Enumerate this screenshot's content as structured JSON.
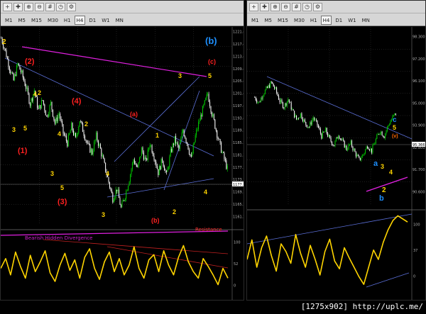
{
  "status_bar": {
    "text": "[1275x902] http://uplc.me/"
  },
  "windows": [
    {
      "id": "left",
      "toolbar": {
        "icons": [
          "new-chart-icon",
          "crosshair-icon",
          "zoom-in-icon",
          "zoom-out-icon",
          "grid-icon",
          "period-icon",
          "properties-icon"
        ],
        "timeframes": [
          "M1",
          "M5",
          "M15",
          "M30",
          "H1",
          "H4",
          "D1",
          "W1",
          "MN"
        ],
        "active_timeframe": "H4"
      },
      "price_axis": [
        "1221.40",
        "1217.45",
        "1213.45",
        "1209.40",
        "1205.40",
        "1201.40",
        "1197.40",
        "1193.40",
        "1189.30",
        "1185.30",
        "1181.30",
        "1177.30",
        "1173.30",
        "1169.30",
        "1165.20",
        "1161.20"
      ],
      "current_price": "1177.13",
      "osc_axis": [
        "100",
        "52",
        "0"
      ],
      "annotations": {
        "divergence": "Bearish Hidden Divergence",
        "resistance": "Resistance"
      },
      "wave_labels": [
        {
          "t": "2",
          "color": "#ffd400"
        },
        {
          "t": "(2)",
          "color": "#ff2020"
        },
        {
          "t": "4",
          "color": "#ffd400"
        },
        {
          "t": "2",
          "color": "#ffd400"
        },
        {
          "t": "3",
          "color": "#ffd400"
        },
        {
          "t": "5",
          "color": "#ffd400"
        },
        {
          "t": "4",
          "color": "#ffd400"
        },
        {
          "t": "(4)",
          "color": "#ff2020"
        },
        {
          "t": "2",
          "color": "#ffd400"
        },
        {
          "t": "(1)",
          "color": "#ff2020"
        },
        {
          "t": "3",
          "color": "#ffd400"
        },
        {
          "t": "5",
          "color": "#ffd400"
        },
        {
          "t": "(3)",
          "color": "#ff2020"
        },
        {
          "t": "4",
          "color": "#ffd400"
        },
        {
          "t": "3",
          "color": "#ffd400"
        },
        {
          "t": "(a)",
          "color": "#ff2020"
        },
        {
          "t": "(b)",
          "color": "#ff2020"
        },
        {
          "t": "1",
          "color": "#ffd400"
        },
        {
          "t": "2",
          "color": "#ffd400"
        },
        {
          "t": "3",
          "color": "#ffd400"
        },
        {
          "t": "4",
          "color": "#ffd400"
        },
        {
          "t": "5",
          "color": "#ffd400"
        },
        {
          "t": "(b)",
          "color": "#1e90ff"
        },
        {
          "t": "(c)",
          "color": "#ff2020"
        }
      ]
    },
    {
      "id": "right",
      "toolbar": {
        "icons": [
          "new-chart-icon",
          "crosshair-icon",
          "zoom-in-icon",
          "zoom-out-icon",
          "grid-icon",
          "period-icon",
          "properties-icon"
        ],
        "timeframes": [
          "M1",
          "M5",
          "M15",
          "M30",
          "H1",
          "H4",
          "D1",
          "W1",
          "MN"
        ],
        "active_timeframe": "H4"
      },
      "price_axis": [
        "98.300",
        "97.200",
        "96.100",
        "95.000",
        "93.900",
        "92.800",
        "91.700",
        "90.600"
      ],
      "current_price": "95.366",
      "osc_axis": [
        "100",
        "37",
        "0"
      ],
      "wave_labels": [
        {
          "t": "c",
          "color": "#1e90ff"
        },
        {
          "t": "5",
          "color": "#ffd400"
        },
        {
          "t": "(v)",
          "color": "#ff6600"
        },
        {
          "t": "a",
          "color": "#1e90ff"
        },
        {
          "t": "3",
          "color": "#ffd400"
        },
        {
          "t": "4",
          "color": "#ffd400"
        },
        {
          "t": "2",
          "color": "#ffd400"
        },
        {
          "t": "b",
          "color": "#1e90ff"
        }
      ]
    }
  ],
  "colors": {
    "bull_candle": "#00c800",
    "bear_candle": "#ffffff",
    "oscillator": "#ffd400",
    "trendline_blue": "#5b6fd8",
    "trendline_magenta": "#e020e0",
    "grid_dot": "#3a3a3a"
  },
  "chart_data": [
    {
      "type": "candlestick",
      "title": "",
      "ylim": [
        1161.2,
        1221.4
      ],
      "close_path": [
        1218,
        1214,
        1209,
        1205,
        1210,
        1207,
        1203,
        1198,
        1202,
        1196,
        1199,
        1194,
        1198,
        1192,
        1195,
        1189,
        1186,
        1191,
        1187,
        1193,
        1189,
        1185,
        1183,
        1188,
        1184,
        1179,
        1174,
        1169,
        1172,
        1166,
        1170,
        1175,
        1181,
        1178,
        1184,
        1180,
        1186,
        1182,
        1177,
        1181,
        1176,
        1183,
        1187,
        1184,
        1190,
        1186,
        1181,
        1188,
        1193,
        1197,
        1201,
        1195,
        1190,
        1185,
        1181,
        1177
      ]
    },
    {
      "type": "line",
      "title": "",
      "ylim": [
        0,
        100
      ],
      "values": [
        45,
        60,
        35,
        70,
        48,
        30,
        65,
        40,
        55,
        72,
        38,
        25,
        50,
        68,
        42,
        58,
        30,
        62,
        75,
        45,
        28,
        55,
        70,
        40,
        60,
        35,
        50,
        78,
        45,
        30,
        58,
        66,
        40,
        72,
        50,
        35,
        62,
        80,
        55,
        40,
        30,
        60,
        48,
        35,
        20,
        45,
        30
      ]
    },
    {
      "type": "candlestick",
      "title": "",
      "ylim": [
        90.6,
        98.3
      ],
      "close_path": [
        96.4,
        96.1,
        96.6,
        96.9,
        97.2,
        96.8,
        96.2,
        95.9,
        96.3,
        95.7,
        95.2,
        95.5,
        95.0,
        94.8,
        95.3,
        94.9,
        94.3,
        94.6,
        94.1,
        93.8,
        94.4,
        94.0,
        93.6,
        93.9,
        93.4,
        93.0,
        93.3,
        93.8,
        93.5,
        94.1,
        94.6,
        94.3,
        94.9,
        95.3,
        95.6
      ]
    },
    {
      "type": "line",
      "title": "",
      "ylim": [
        0,
        100
      ],
      "values": [
        40,
        65,
        30,
        55,
        70,
        45,
        25,
        60,
        50,
        35,
        72,
        48,
        30,
        58,
        40,
        20,
        50,
        66,
        38,
        28,
        55,
        42,
        30,
        18,
        8,
        30,
        52,
        40,
        62,
        78,
        90,
        96,
        92,
        88
      ]
    }
  ]
}
